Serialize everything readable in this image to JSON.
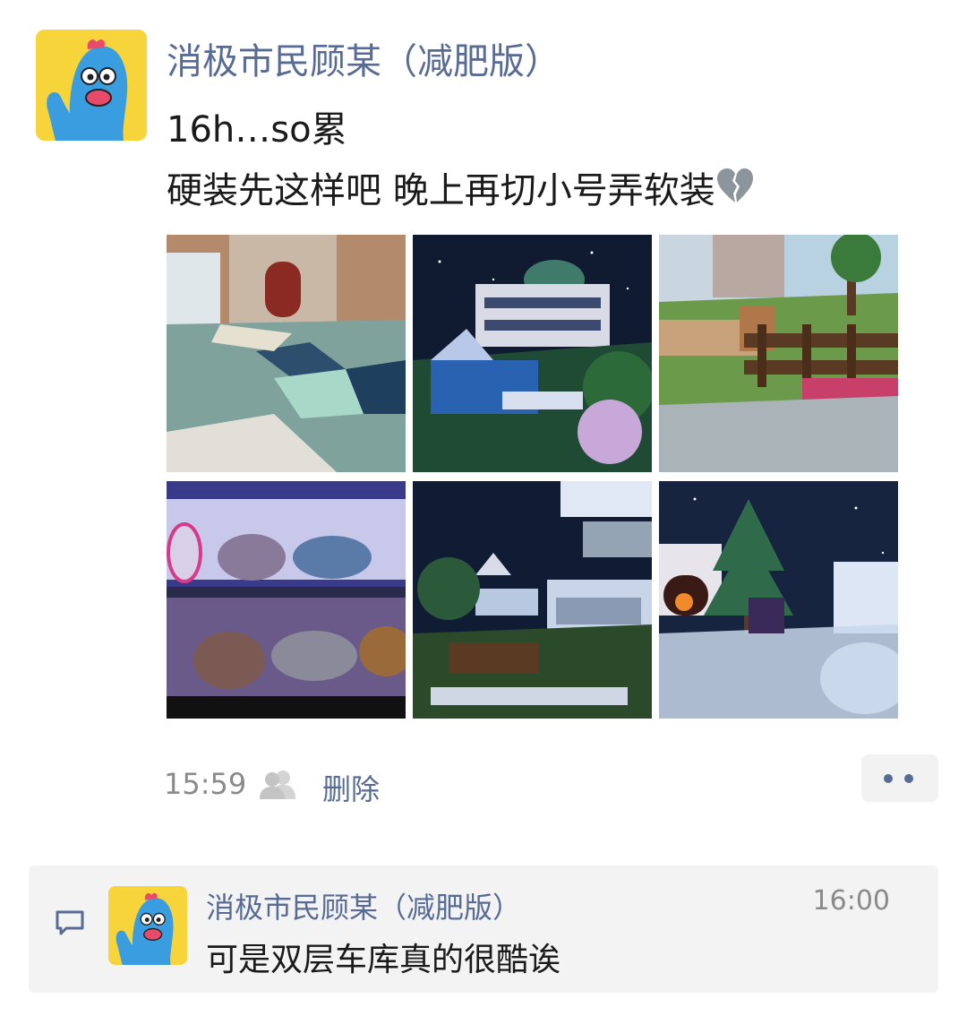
{
  "post": {
    "author": "消极市民顾某（减肥版）",
    "line1": "16h…so累",
    "line2": "硬装先这样吧 晚上再切小号弄软装",
    "emoji": "broken-heart-icon",
    "images": [
      {
        "name": "photo-garden-entrance"
      },
      {
        "name": "photo-night-mansion"
      },
      {
        "name": "photo-farm-fence"
      },
      {
        "name": "photo-double-garage"
      },
      {
        "name": "photo-night-garden-rooms"
      },
      {
        "name": "photo-christmas-tree"
      }
    ],
    "time": "15:59",
    "visibility_icon": "friends-icon",
    "delete_label": "删除",
    "more_icon": "more-icon"
  },
  "comments": {
    "icon": "comment-icon",
    "items": [
      {
        "author": "消极市民顾某（减肥版）",
        "time": "16:00",
        "text": "可是双层车库真的很酷诶"
      }
    ]
  },
  "colors": {
    "link": "#576b95",
    "avatar_bg": "#f7d53a",
    "character": "#3a9de0"
  }
}
